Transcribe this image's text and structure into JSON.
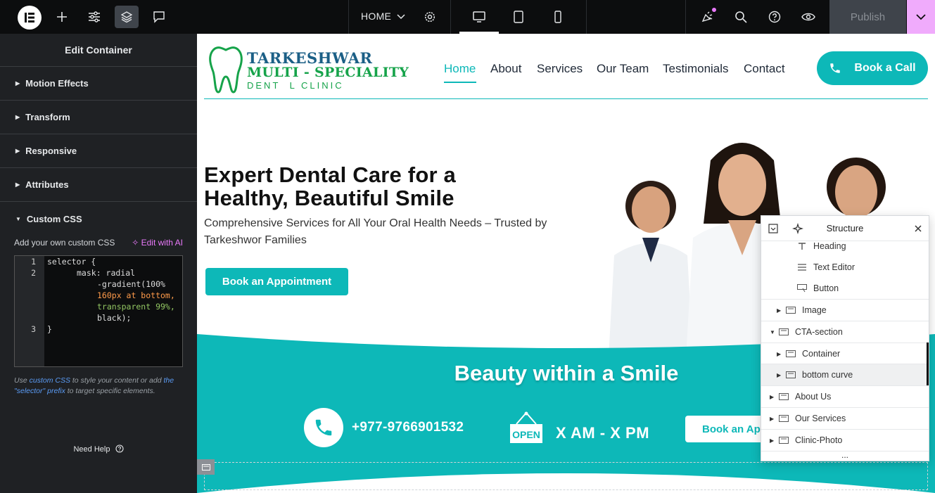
{
  "topbar": {
    "page_name": "HOME",
    "publish_label": "Publish",
    "icons": [
      "elementor-logo-icon",
      "add-element-icon",
      "site-settings-icon",
      "structure-icon",
      "notes-icon",
      "chevron-down-icon",
      "page-settings-icon",
      "desktop-icon",
      "tablet-icon",
      "mobile-icon",
      "whats-new-icon",
      "search-icon",
      "help-icon",
      "preview-icon"
    ],
    "accent_color": "#f0abfc"
  },
  "panel": {
    "title": "Edit Container",
    "sections": [
      "Motion Effects",
      "Transform",
      "Responsive",
      "Attributes",
      "Custom CSS"
    ],
    "custom_css_label": "Add your own custom CSS",
    "edit_ai_label": "Edit with AI",
    "code": {
      "line_numbers": [
        "1",
        "2",
        "3"
      ],
      "lines": [
        "selector {",
        "mask: radial",
        "-gradient(100%",
        "160px at bottom,",
        "transparent 99%,",
        "black);",
        "}"
      ]
    },
    "hint": {
      "use": "Use",
      "link1": "custom CSS",
      "mid": "to style your content or add",
      "link2": "the \"selector\" prefix",
      "end": "to target specific elements."
    },
    "need_help": "Need Help"
  },
  "site": {
    "logo_line1": "TARKESHWAR",
    "logo_line2": "MULTI - SPECIALITY",
    "logo_line3": "DENT  L CLINIC",
    "nav": [
      "Home",
      "About",
      "Services",
      "Our Team",
      "Testimonials",
      "Contact"
    ],
    "book_call": "Book a Call",
    "hero_title": "Expert Dental Care for a Healthy, Beautiful Smile",
    "hero_subtitle": "Comprehensive Services for All Your Oral Health Needs – Trusted by Tarkeshwor Families",
    "hero_button": "Book an Appointment",
    "cta_heading": "Beauty within a Smile",
    "phone": "+977-9766901532",
    "open_sign": "OPEN",
    "hours": "X AM - X PM",
    "cta_button": "Book an Appointment",
    "brand_color": "#0db8b8"
  },
  "structure": {
    "title": "Structure",
    "rows": [
      {
        "label": "Heading",
        "indent": 2,
        "icon": "heading-icon",
        "arrow": ""
      },
      {
        "label": "Text Editor",
        "indent": 2,
        "icon": "text-editor-icon",
        "arrow": ""
      },
      {
        "label": "Button",
        "indent": 2,
        "icon": "button-icon",
        "arrow": ""
      },
      {
        "label": "Image",
        "indent": 1,
        "icon": "container-icon",
        "arrow": "▶"
      },
      {
        "label": "CTA-section",
        "indent": 0,
        "icon": "container-icon",
        "arrow": "▼"
      },
      {
        "label": "Container",
        "indent": 1,
        "icon": "container-icon",
        "arrow": "▶"
      },
      {
        "label": "bottom curve",
        "indent": 1,
        "icon": "container-icon",
        "arrow": "▶"
      },
      {
        "label": "About Us",
        "indent": 0,
        "icon": "container-icon",
        "arrow": "▶"
      },
      {
        "label": "Our Services",
        "indent": 0,
        "icon": "container-icon",
        "arrow": "▶"
      },
      {
        "label": "Clinic-Photo",
        "indent": 0,
        "icon": "container-icon",
        "arrow": "▶"
      }
    ],
    "more": "..."
  }
}
